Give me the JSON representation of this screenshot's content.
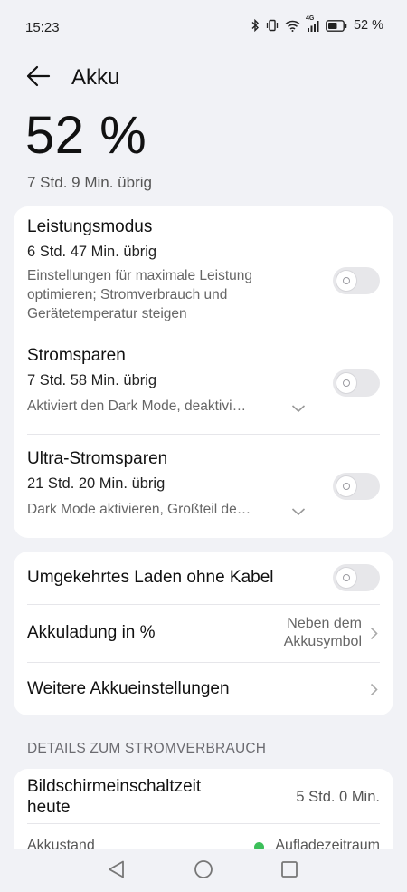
{
  "status": {
    "time": "15:23",
    "battery_percent": "52 %",
    "network": "4G"
  },
  "header": {
    "title": "Akku"
  },
  "battery": {
    "level": "52 %",
    "remaining": "7 Std. 9 Min. übrig"
  },
  "modes": [
    {
      "title": "Leistungsmodus",
      "remaining": "6 Std. 47 Min. übrig",
      "desc_line1": "Einstellungen für maximale Leistung",
      "desc_line2": "optimieren; Stromverbrauch und",
      "desc_line3": "Gerätetemperatur steigen",
      "enabled": false
    },
    {
      "title": "Stromsparen",
      "remaining": "7 Std. 58 Min. übrig",
      "desc": "Aktiviert den Dark Mode, deaktivi…",
      "enabled": false
    },
    {
      "title": "Ultra-Stromsparen",
      "remaining": "21 Std. 20 Min. übrig",
      "desc": "Dark Mode aktivieren, Großteil de…",
      "enabled": false
    }
  ],
  "settings": {
    "reverse_charging": {
      "label": "Umgekehrtes Laden ohne Kabel",
      "enabled": false
    },
    "battery_percent": {
      "label": "Akkuladung in %",
      "value_line1": "Neben dem",
      "value_line2": "Akkusymbol"
    },
    "more": {
      "label": "Weitere Akkueinstellungen"
    }
  },
  "usage": {
    "section_title": "DETAILS ZUM STROMVERBRAUCH",
    "screen_time_label_line1": "Bildschirmeinschaltzeit",
    "screen_time_label_line2": "heute",
    "screen_time_value": "5 Std. 0 Min.",
    "battery_state_label": "Akkustand",
    "charging_period_label": "Aufladezeitraum",
    "charging_color": "#3cbf5a"
  }
}
